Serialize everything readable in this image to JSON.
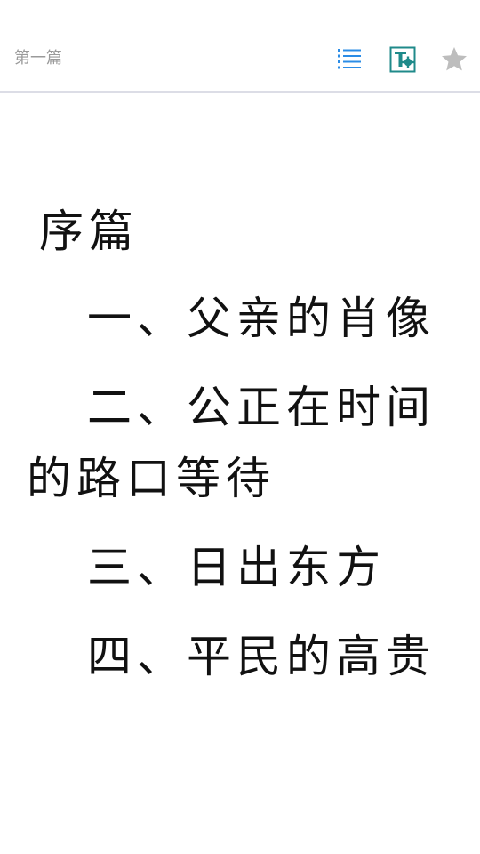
{
  "header": {
    "chapter": "第一篇",
    "icons": {
      "toc": "list-icon",
      "text_settings": "text-format-icon",
      "favorite": "star-icon"
    },
    "colors": {
      "accent": "#2b8ce6",
      "teal": "#1f8a8a",
      "star": "#bdbdbd",
      "divider": "#dcdde6"
    }
  },
  "content": {
    "lines": [
      "序篇",
      "一、父亲的肖像",
      "二、公正在时间",
      "的路口等待",
      "三、日出东方",
      "四、平民的高贵"
    ]
  }
}
